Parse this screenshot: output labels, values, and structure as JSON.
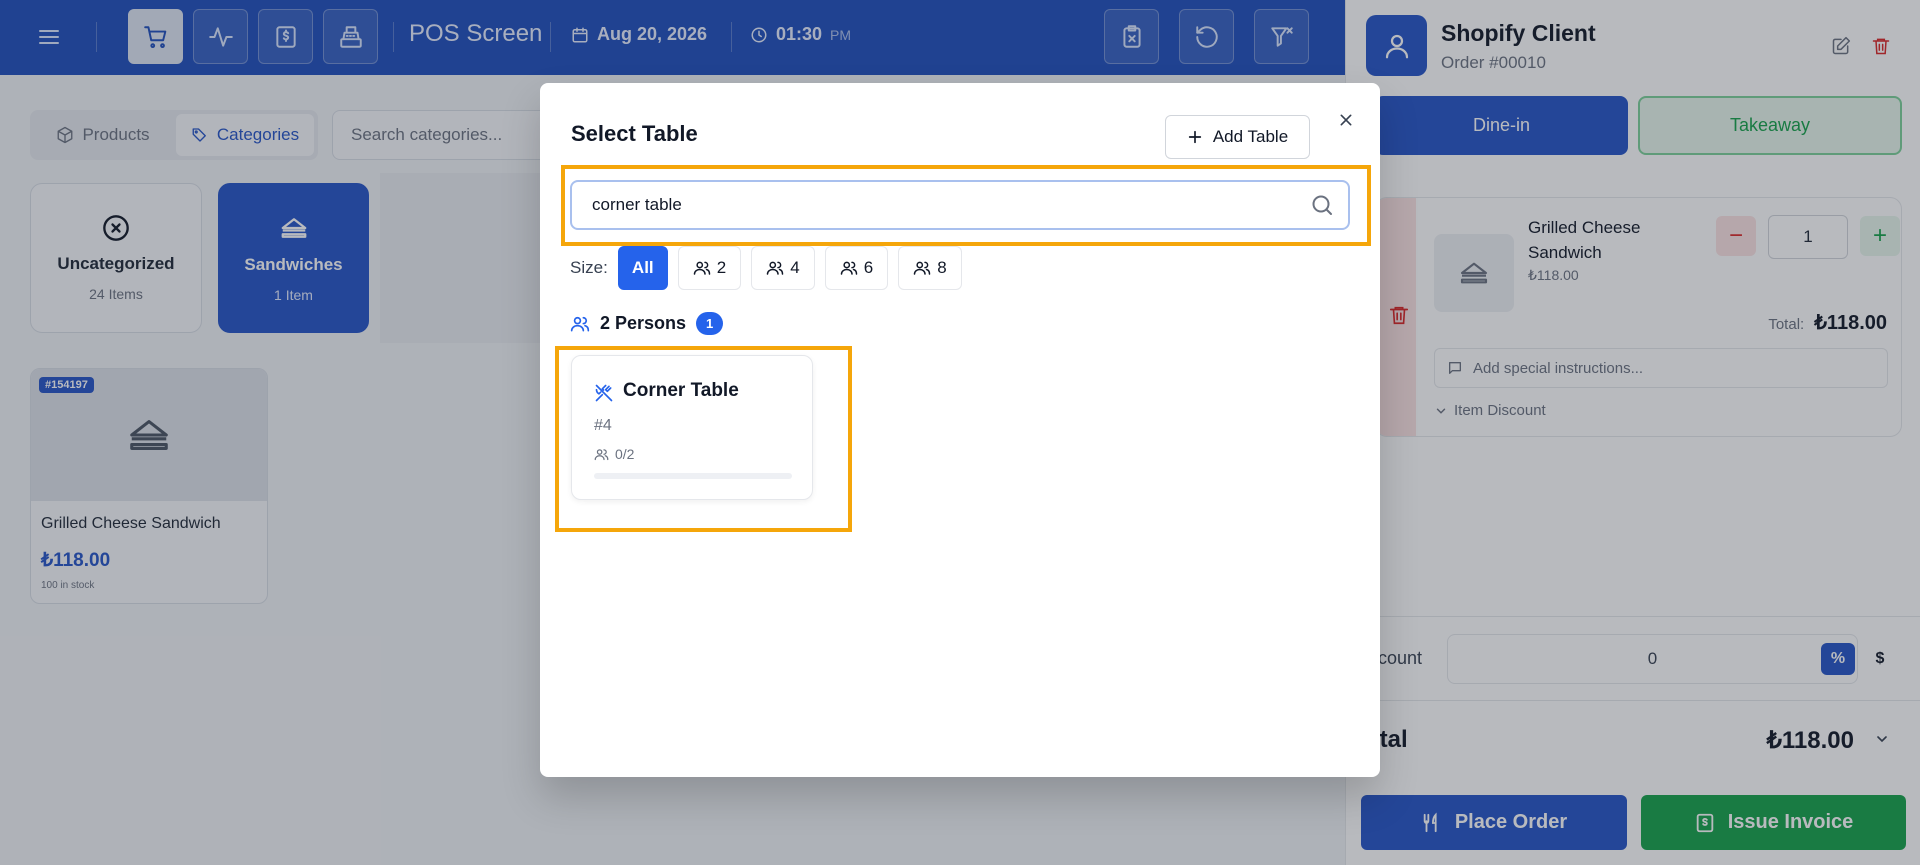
{
  "topbar": {
    "title": "POS Screen",
    "date": "Aug 20, 2026",
    "time": "01:30",
    "ampm": "PM"
  },
  "left": {
    "tabs": [
      {
        "label": "Products"
      },
      {
        "label": "Categories"
      }
    ],
    "search_placeholder": "Search categories...",
    "categories": [
      {
        "name": "Uncategorized",
        "count": "24 Items"
      },
      {
        "name": "Sandwiches",
        "count": "1 Item"
      }
    ],
    "product": {
      "badge": "#154197",
      "name": "Grilled Cheese Sandwich",
      "price": "₺118.00",
      "stock": "100 in stock"
    }
  },
  "panel": {
    "customer_name": "Shopify Client",
    "order_number": "Order #00010",
    "order_types": [
      "Dine-in",
      "Takeaway"
    ],
    "item": {
      "name": "Grilled Cheese Sandwich",
      "unit_price": "₺118.00",
      "qty": "1",
      "total_label": "Total:",
      "total": "₺118.00",
      "instructions_placeholder": "Add special instructions...",
      "discount_label": "Item Discount"
    },
    "discount": {
      "label": "iscount",
      "value": "0",
      "pct": "%",
      "usd": "$"
    },
    "total": {
      "label": "otal",
      "value": "₺118.00"
    },
    "place_order": "Place Order",
    "issue_invoice": "Issue Invoice"
  },
  "modal": {
    "title": "Select Table",
    "add_button": "Add Table",
    "search_value": "corner table",
    "size_label": "Size:",
    "sizes": [
      "All",
      "2",
      "4",
      "6",
      "8"
    ],
    "group": {
      "name": "2 Persons",
      "count": "1"
    },
    "table": {
      "name": "Corner Table",
      "number": "#4",
      "occupancy": "0/2",
      "fill": 0
    }
  },
  "colors": {
    "primary": "#2554c7",
    "topbar": "#1f4fbd",
    "success": "#16a34a",
    "danger": "#dc2626",
    "highlight": "#f5a60a"
  }
}
